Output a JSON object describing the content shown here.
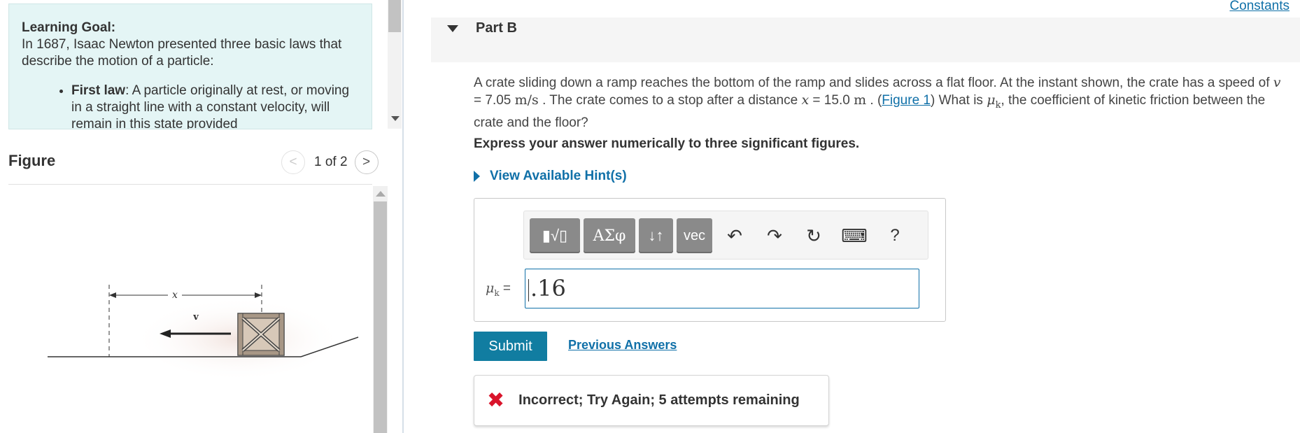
{
  "learning_goal": {
    "title": "Learning Goal:",
    "intro": "In 1687, Isaac Newton presented three basic laws that describe the motion of a particle:",
    "bullet_term": "First law",
    "bullet_text": ": A particle originally at rest, or moving in a straight line with a constant velocity, will remain in this state provided"
  },
  "figure": {
    "label": "Figure",
    "page": "1 of 2",
    "prev_glyph": "<",
    "next_glyph": ">",
    "x_label": "x",
    "v_label": "v"
  },
  "header": {
    "constants_link": "Constants",
    "part_title": "Part B"
  },
  "question": {
    "t1": "A crate sliding down a ramp reaches the bottom of the ramp and slides across a flat floor. At the instant shown, the crate has a speed of ",
    "v_sym": "v",
    "v_eq": " = 7.05 ",
    "v_unit": "m/s",
    "t2": " .  The crate comes to a stop after a distance ",
    "x_sym": "x",
    "x_eq": " = 15.0 ",
    "x_unit": "m",
    "t3": " . (",
    "fig_link": "Figure 1",
    "t4": ") What is ",
    "mu_sym": "μ",
    "mu_sub": "k",
    "t5": ", the coefficient of kinetic friction between the crate and the floor?"
  },
  "instruction": "Express your answer numerically to three significant figures.",
  "hint_link": "View Available Hint(s)",
  "toolbar": {
    "templates_label": "▮√▯",
    "greek_label": "ΑΣφ",
    "arrows_label": "↓↑",
    "vec_label": "vec",
    "undo_icon": "↶",
    "redo_icon": "↷",
    "reset_icon": "↻",
    "keyboard_icon": "⌨",
    "help_label": "?"
  },
  "answer": {
    "label_sym": "μ",
    "label_sub": "k",
    "label_eq": " =",
    "value": ".16"
  },
  "actions": {
    "submit": "Submit",
    "previous_answers": "Previous Answers"
  },
  "feedback": {
    "icon": "✖",
    "message": "Incorrect; Try Again; 5 attempts remaining"
  },
  "colors": {
    "accent": "#1070a8",
    "submit": "#117da1",
    "error": "#d9142b",
    "goal_bg": "#e4f5f5"
  }
}
